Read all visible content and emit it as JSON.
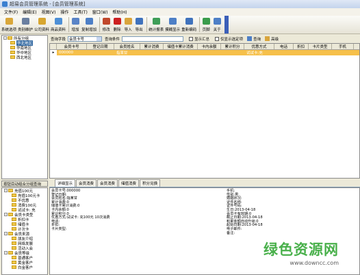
{
  "window": {
    "title": "超易会员管理系统 - [会员管理系统]"
  },
  "menu": [
    "文件(F)",
    "编辑(E)",
    "视图(V)",
    "操作",
    "工具(T)",
    "窗口(W)",
    "帮助(H)"
  ],
  "toolbar": [
    {
      "label": "系统选项",
      "icon": "settings-icon",
      "color": "#d9a73a"
    },
    {
      "label": "类别维护",
      "icon": "tools-icon",
      "color": "#6a7fa0"
    },
    {
      "label": "公司资料",
      "icon": "company-icon",
      "color": "#d7a630"
    },
    {
      "label": "商品资料",
      "icon": "product-icon",
      "color": "#4d8fd6"
    },
    {
      "label": "增加",
      "icon": "add-icon",
      "color": "#5a84c7"
    },
    {
      "label": "复制增加",
      "icon": "copy-icon",
      "color": "#4d7fc6"
    },
    {
      "label": "修改",
      "icon": "edit-icon",
      "color": "#c0482c"
    },
    {
      "label": "删除",
      "icon": "delete-icon",
      "color": "#cc2020"
    },
    {
      "label": "导入",
      "icon": "import-icon",
      "color": "#d9a53c"
    },
    {
      "label": "导出",
      "icon": "export-icon",
      "color": "#3f72bc"
    },
    {
      "label": "统计报表",
      "icon": "report-icon",
      "color": "#3f9e57"
    },
    {
      "label": "摸糊显示",
      "icon": "blur-icon",
      "color": "#4d7fc6"
    },
    {
      "label": "重新编码",
      "icon": "recode-icon",
      "color": "#3f72bc"
    },
    {
      "label": "页脚",
      "icon": "footer-icon",
      "color": "#3a9c4b"
    },
    {
      "label": "关于",
      "icon": "help-icon",
      "color": "#4d7fc6"
    }
  ],
  "tree": {
    "root": "所有分组",
    "items": [
      "华北地区",
      "华南地区",
      "华中地区",
      "西北地区"
    ],
    "selected": "华北地区"
  },
  "search": {
    "field_label": "查询字段",
    "field_value": "会员卡号",
    "condition_label": "查询条件",
    "show_summary": "显示汇总",
    "show_selected": "仅显示选定项",
    "query_button": "查询",
    "advanced_button": "高级"
  },
  "grid": {
    "columns": [
      "会员卡号",
      "登记日期",
      "会员姓名",
      "累计消费",
      "储值卡累计消费",
      "卡内余额",
      "累计积分",
      "优惠方式",
      "电话",
      "折扣",
      "卡片类型",
      "手机"
    ],
    "row": [
      "000000",
      "",
      "指某甘",
      "",
      "",
      "",
      "",
      "试试卡:充",
      "",
      "",
      "",
      ""
    ]
  },
  "left_bottom": {
    "tab_label": "按钮目动组合分组查询",
    "tree": [
      {
        "level": 0,
        "label": "充值100元"
      },
      {
        "level": 1,
        "label": "充值100元卡"
      },
      {
        "level": 1,
        "label": "不优惠"
      },
      {
        "level": 1,
        "label": "消费100元"
      },
      {
        "level": 1,
        "label": "试试卡: 充"
      },
      {
        "level": 0,
        "label": "会员卡类型"
      },
      {
        "level": 1,
        "label": "折扣卡"
      },
      {
        "level": 1,
        "label": "储值卡"
      },
      {
        "level": 1,
        "label": "计次卡"
      },
      {
        "level": 0,
        "label": "会员来源"
      },
      {
        "level": 1,
        "label": "朋友介绍"
      },
      {
        "level": 1,
        "label": "网络发展"
      },
      {
        "level": 1,
        "label": "活动入会"
      },
      {
        "level": 0,
        "label": "会员等级"
      },
      {
        "level": 1,
        "label": "普通客户"
      },
      {
        "level": 1,
        "label": "黄金客户"
      },
      {
        "level": 1,
        "label": "白金客户"
      }
    ]
  },
  "tabs": [
    "详细显示",
    "会员消费",
    "会员消费",
    "储值消费",
    "积分兑换"
  ],
  "detail": {
    "left": [
      {
        "k": "会员卡号:",
        "v": "000000"
      },
      {
        "k": "登记日期:",
        "v": ""
      },
      {
        "k": "会员姓名:",
        "v": "指某甘"
      },
      {
        "k": "累计消费:",
        "v": "0"
      },
      {
        "k": "储值卡累计消费:",
        "v": "0"
      },
      {
        "k": "卡内余额:",
        "v": "0"
      },
      {
        "k": "累计积分:",
        "v": "0"
      },
      {
        "k": "优惠方式:",
        "v": "试试卡: 充100元 10次消费"
      },
      {
        "k": "电话:",
        "v": ""
      },
      {
        "k": "折扣:",
        "v": ""
      },
      {
        "k": "卡片类型:",
        "v": ""
      }
    ],
    "right": [
      {
        "k": "手机:",
        "v": ""
      },
      {
        "k": "性别:",
        "v": "男"
      },
      {
        "k": "婚姻状况:",
        "v": ""
      },
      {
        "k": "证件名称:",
        "v": ""
      },
      {
        "k": "证件号码:",
        "v": ""
      },
      {
        "k": "生日:",
        "v": "2013-04-18"
      },
      {
        "k": "会员卡有效期:",
        "v": "0"
      },
      {
        "k": "截止日期:",
        "v": "2013-04-18"
      },
      {
        "k": "积累金额自动升级:",
        "v": "0"
      },
      {
        "k": "起始日期:",
        "v": "2013-04-18"
      },
      {
        "k": "电子邮件:",
        "v": ""
      },
      {
        "k": "备注:",
        "v": ""
      }
    ]
  },
  "watermark": {
    "text": "绿色资源网",
    "url": "www.downcc.com"
  }
}
